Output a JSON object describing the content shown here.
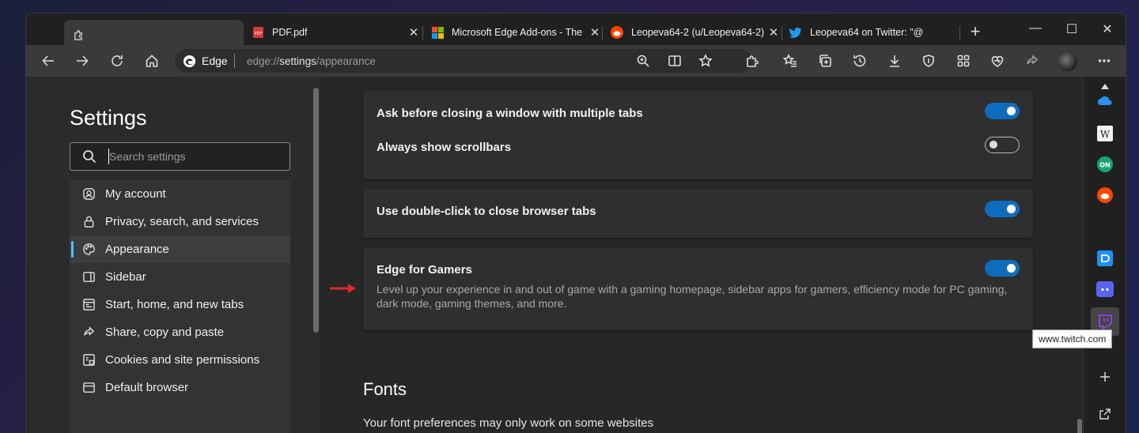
{
  "tabs": [
    {
      "title": "",
      "active": true
    },
    {
      "title": "PDF.pdf",
      "active": false
    },
    {
      "title": "Microsoft Edge Add-ons - The",
      "active": false
    },
    {
      "title": "Leopeva64-2 (u/Leopeva64-2)",
      "active": false
    },
    {
      "title": "Leopeva64 on Twitter: \"@",
      "active": false
    }
  ],
  "window_controls": {
    "minimize": "—",
    "maximize": "☐",
    "close": "✕"
  },
  "new_tab": "+",
  "address_bar": {
    "brand": "Edge",
    "url_scheme": "edge://",
    "url_rest": "settings",
    "url_path": "/appearance"
  },
  "settings": {
    "title": "Settings",
    "search_placeholder": "Search settings",
    "nav": [
      {
        "label": "My account",
        "icon": "account-icon"
      },
      {
        "label": "Privacy, search, and services",
        "icon": "lock-icon"
      },
      {
        "label": "Appearance",
        "icon": "palette-icon",
        "selected": true
      },
      {
        "label": "Sidebar",
        "icon": "sidebar-icon"
      },
      {
        "label": "Start, home, and new tabs",
        "icon": "home-icon"
      },
      {
        "label": "Share, copy and paste",
        "icon": "share-icon"
      },
      {
        "label": "Cookies and site permissions",
        "icon": "cookies-icon"
      },
      {
        "label": "Default browser",
        "icon": "browser-icon"
      }
    ]
  },
  "main": {
    "card1": {
      "row1": {
        "label": "Ask before closing a window with multiple tabs",
        "on": true
      },
      "row2": {
        "label": "Always show scrollbars",
        "on": false
      }
    },
    "card2": {
      "label": "Use double-click to close browser tabs",
      "on": true
    },
    "card3": {
      "label": "Edge for Gamers",
      "on": true,
      "description": "Level up your experience in and out of game with a gaming homepage, sidebar apps for gamers, efficiency mode for PC gaming, dark mode, gaming themes, and more."
    },
    "fonts_heading": "Fonts",
    "fonts_note": "Your font preferences may only work on some websites"
  },
  "sidebar": {
    "tooltip": "www.twitch.com"
  },
  "colors": {
    "accent": "#0f6cbd",
    "indicator": "#4cc2ff",
    "arrow": "#e02828"
  }
}
